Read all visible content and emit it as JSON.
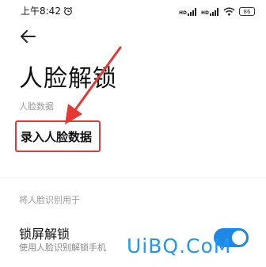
{
  "status_bar": {
    "time": "上午8:42",
    "network_label": "HD",
    "battery": "86"
  },
  "icons": {
    "back": "back-arrow-icon",
    "alarm": "alarm-clock-icon",
    "signal": "cellular-signal-icon",
    "wifi": "wifi-icon",
    "battery": "battery-icon"
  },
  "page": {
    "title": "人脸解锁",
    "section_face_data": "人脸数据",
    "enroll_label": "录入人脸数据",
    "section_use_for": "将人脸识别用于",
    "lock_title": "锁屏解锁",
    "lock_subtitle": "使用人脸识别解锁手机",
    "lock_enabled": true
  },
  "annotation": {
    "highlight_color": "#e53935"
  },
  "watermark": "UiBQ.CoM",
  "colors": {
    "accent": "#1e88e5",
    "watermark": "#2196f3",
    "secondary_text": "#9a9a9a"
  }
}
